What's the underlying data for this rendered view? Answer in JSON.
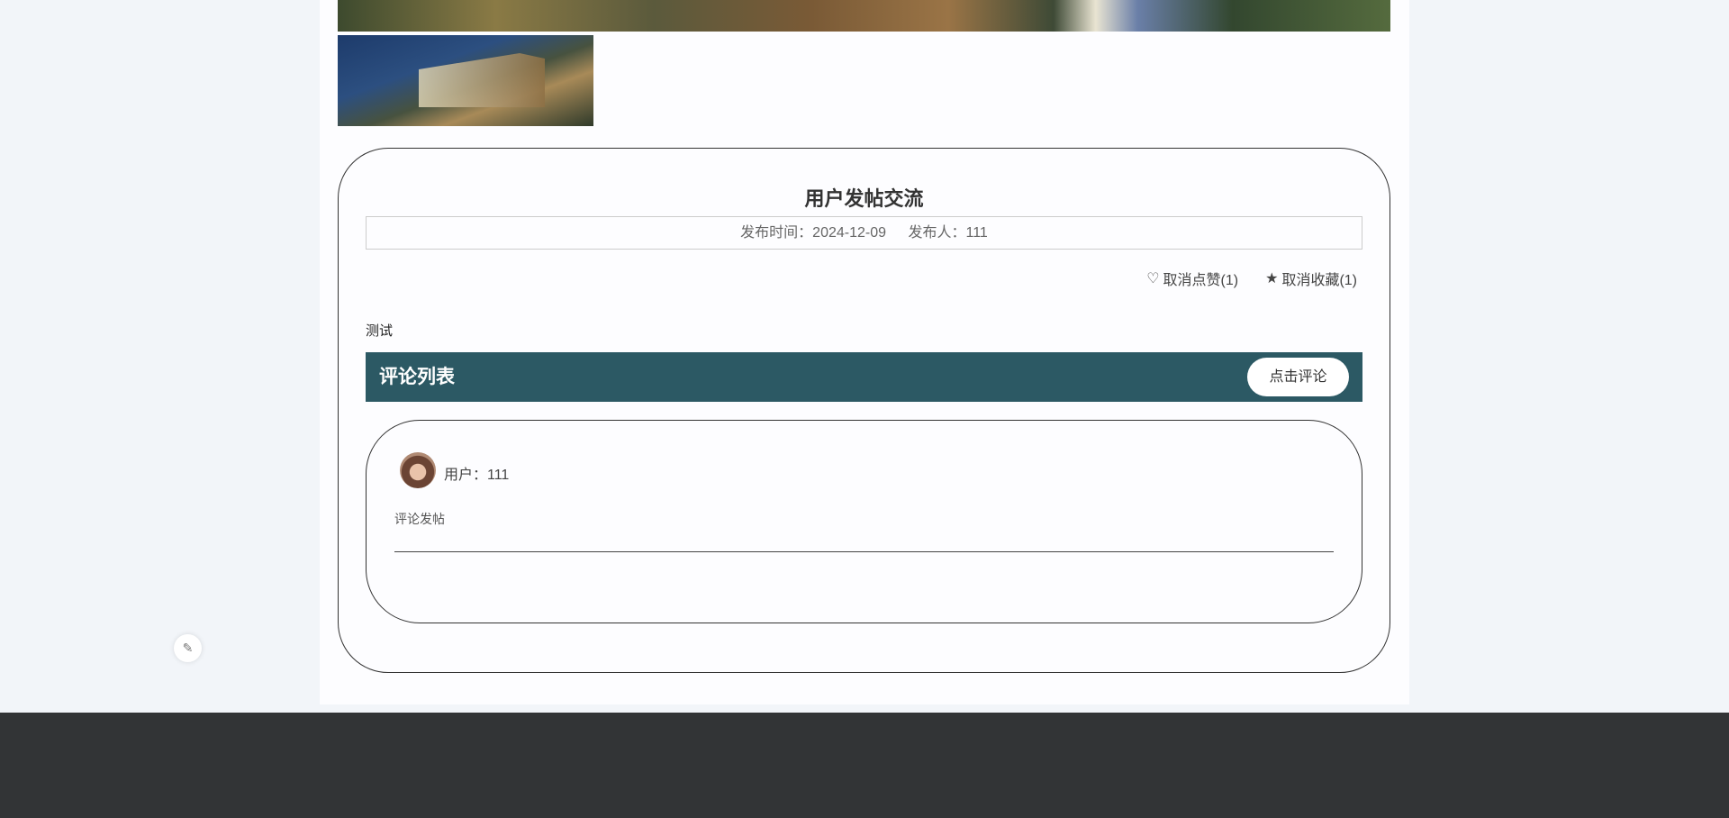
{
  "post": {
    "title": "用户发帖交流",
    "publish_time_label": "发布时间：2024-12-09",
    "publisher_label": "发布人：111",
    "like_label": "取消点赞(1)",
    "favorite_label": "取消收藏(1)",
    "content": "测试"
  },
  "comments": {
    "header": "评论列表",
    "add_button": "点击评论",
    "items": [
      {
        "user_label": "用户：111",
        "text": "评论发帖"
      }
    ]
  },
  "icons": {
    "like": "heart-outline-icon",
    "favorite": "star-icon",
    "float": "edit-note-icon"
  }
}
